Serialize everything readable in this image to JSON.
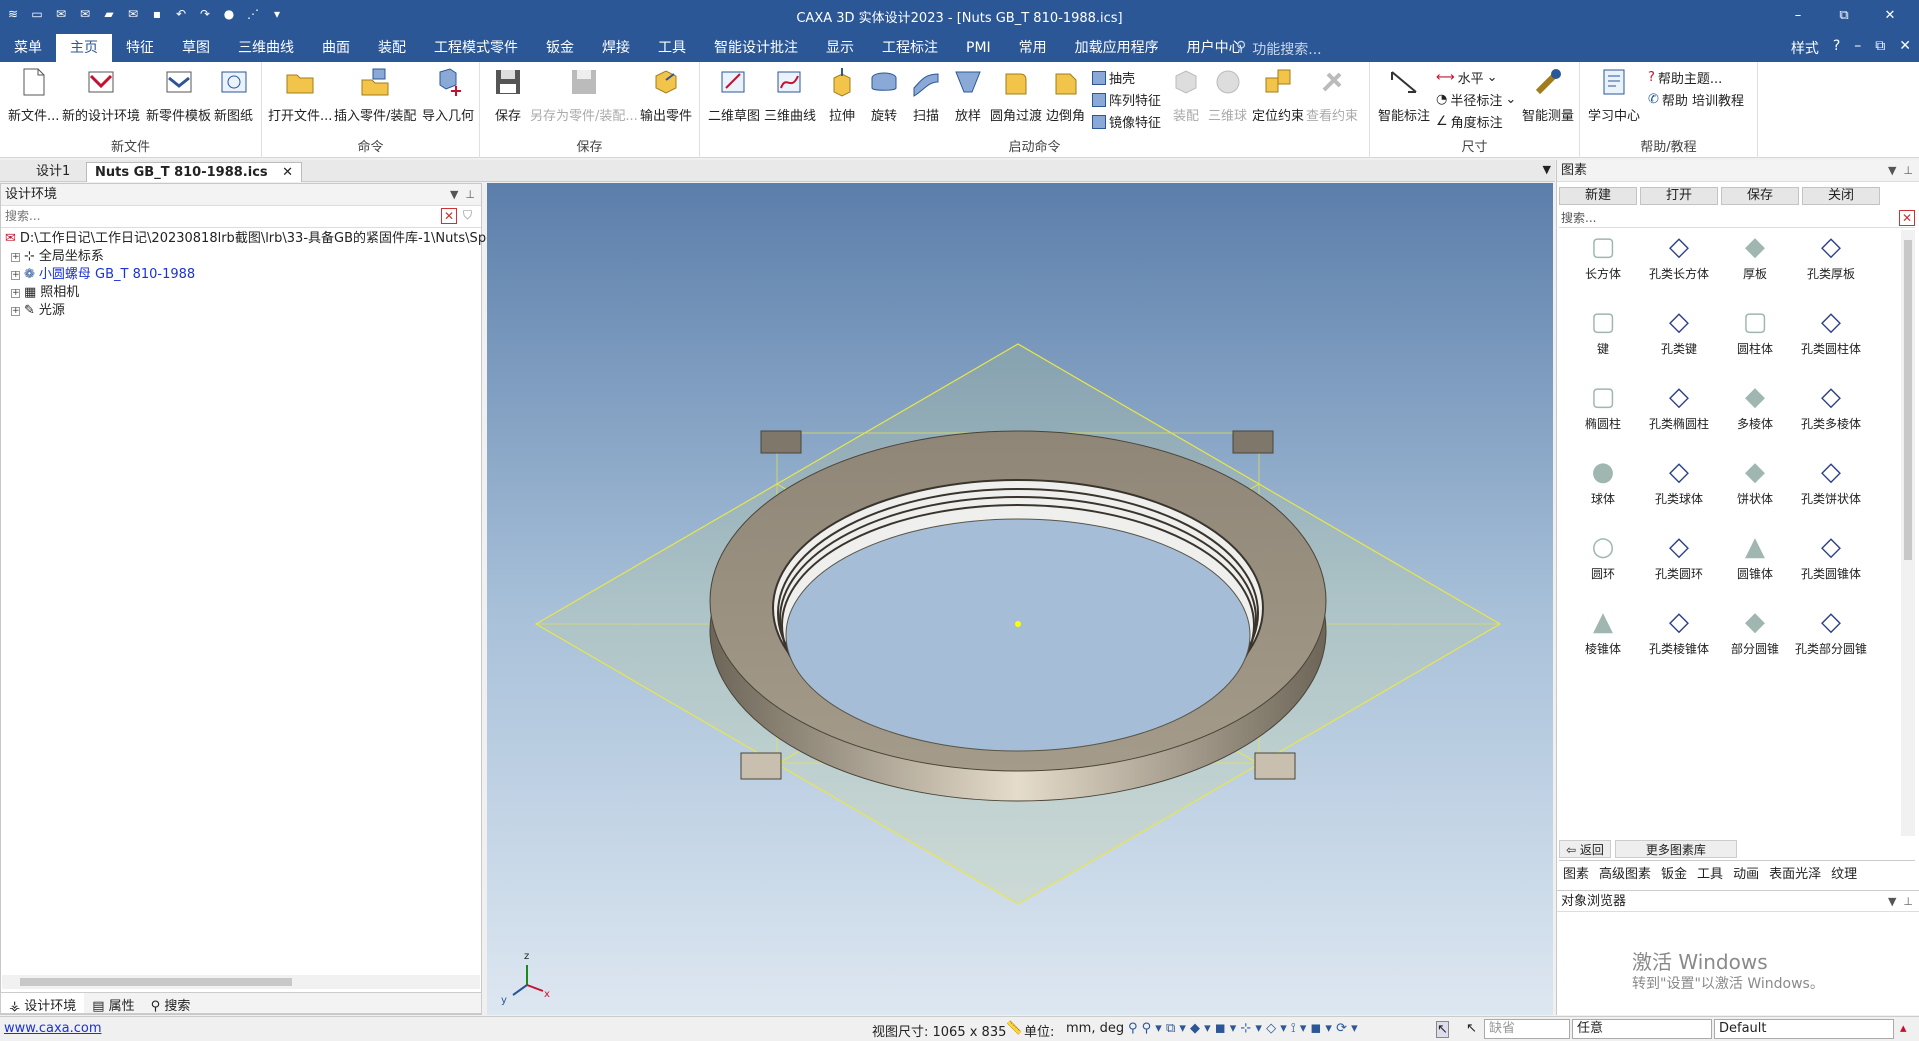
{
  "window": {
    "title": "CAXA 3D 实体设计2023 - [Nuts GB_T 810-1988.ics]",
    "minimize": "–",
    "restore": "⧉",
    "close": "✕"
  },
  "menu_tabs": [
    "菜单",
    "主页",
    "特征",
    "草图",
    "三维曲线",
    "曲面",
    "装配",
    "工程模式零件",
    "钣金",
    "焊接",
    "工具",
    "智能设计批注",
    "显示",
    "工程标注",
    "PMI",
    "常用",
    "加载应用程序",
    "用户中心"
  ],
  "menu_search_placeholder": "功能搜索...",
  "menu_right": {
    "style": "样式"
  },
  "ribbon": {
    "new_file": {
      "caption": "新文件",
      "items": [
        "新文件...",
        "新的设计环境",
        "新零件模板",
        "新图纸"
      ]
    },
    "command": {
      "caption": "命令",
      "items": [
        "打开文件...",
        "插入零件/装配",
        "导入几何"
      ]
    },
    "save": {
      "caption": "保存",
      "items": [
        "保存",
        "另存为零件/装配...",
        "输出零件"
      ]
    },
    "launch": {
      "caption": "启动命令",
      "items": [
        "二维草图",
        "三维曲线",
        "拉伸",
        "旋转",
        "扫描",
        "放样",
        "圆角过渡",
        "边倒角"
      ],
      "small": [
        "抽壳",
        "阵列特征",
        "镜像特征"
      ],
      "disabled": [
        "装配",
        "三维球",
        "定位约束",
        "查看约束"
      ]
    },
    "dimension": {
      "caption": "尺寸",
      "items": [
        "智能标注",
        "智能测量"
      ],
      "small": [
        "水平",
        "半径标注",
        "角度标注"
      ]
    },
    "help": {
      "caption": "帮助/教程",
      "items": [
        "学习中心"
      ],
      "small": [
        "帮助主题...",
        "帮助 培训教程"
      ]
    }
  },
  "doc_tabs": [
    "设计1",
    "Nuts GB_T 810-1988.ics"
  ],
  "left_panel": {
    "title": "设计环境",
    "search_placeholder": "搜索...",
    "tree": [
      "D:\\工作日记\\工作日记\\20230818lrb截图\\lrb\\33-具备GB的紧固件库-1\\Nuts\\Specia",
      "全局坐标系",
      "小圆螺母 GB_T 810-1988",
      "照相机",
      "光源"
    ],
    "bottom_tabs": [
      "设计环境",
      "属性",
      "搜索"
    ]
  },
  "right_panel": {
    "title": "图素",
    "toolbar": [
      "新建",
      "打开",
      "保存",
      "关闭"
    ],
    "search_placeholder": "搜索...",
    "items": [
      "长方体",
      "孔类长方体",
      "厚板",
      "孔类厚板",
      "键",
      "孔类键",
      "圆柱体",
      "孔类圆柱体",
      "椭圆柱",
      "孔类椭圆柱",
      "多棱体",
      "孔类多棱体",
      "球体",
      "孔类球体",
      "饼状体",
      "孔类饼状体",
      "圆环",
      "孔类圆环",
      "圆锥体",
      "孔类圆锥体",
      "棱锥体",
      "孔类棱锥体",
      "部分圆锥",
      "孔类部分圆锥"
    ],
    "back": "返回",
    "more": "更多图素库",
    "lib_tabs": [
      "图素",
      "高级图素",
      "钣金",
      "工具",
      "动画",
      "表面光泽",
      "纹理"
    ],
    "browser_title": "对象浏览器"
  },
  "watermark": {
    "line1": "激活 Windows",
    "line2": "转到\"设置\"以激活 Windows。"
  },
  "status": {
    "url": "www.caxa.com",
    "view_size": "视图尺寸: 1065 x  835",
    "unit_label": "单位:",
    "unit_value": "mm, deg",
    "combo1": "缺省",
    "combo2": "任意",
    "combo3": "Default"
  },
  "triad": {
    "x": "x",
    "y": "y",
    "z": "z"
  }
}
